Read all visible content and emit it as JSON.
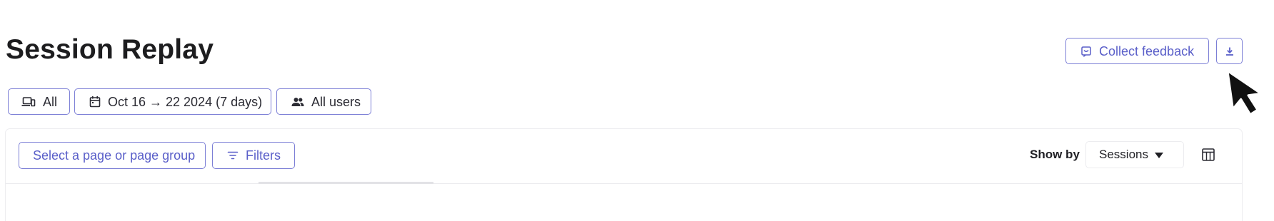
{
  "page": {
    "title": "Session Replay"
  },
  "header_actions": {
    "collect_feedback_label": "Collect feedback",
    "collect_feedback_icon": "feedback-icon",
    "download_icon": "download-icon"
  },
  "filters": {
    "device": {
      "label": "All",
      "icon": "devices-icon"
    },
    "date_range": {
      "label": "Oct 16 → 22 2024 (7 days)",
      "icon": "calendar-icon"
    },
    "users": {
      "label": "All users",
      "icon": "users-icon"
    }
  },
  "toolbar": {
    "page_select_label": "Select a page or page group",
    "filters_label": "Filters",
    "filters_icon": "filter-lines-icon",
    "show_by_label": "Show by",
    "show_by_value": "Sessions",
    "columns_icon": "table-columns-icon"
  },
  "colors": {
    "accent": "#5a5fc9",
    "accent_border": "#7c7fd6",
    "text": "#1f1f24"
  }
}
